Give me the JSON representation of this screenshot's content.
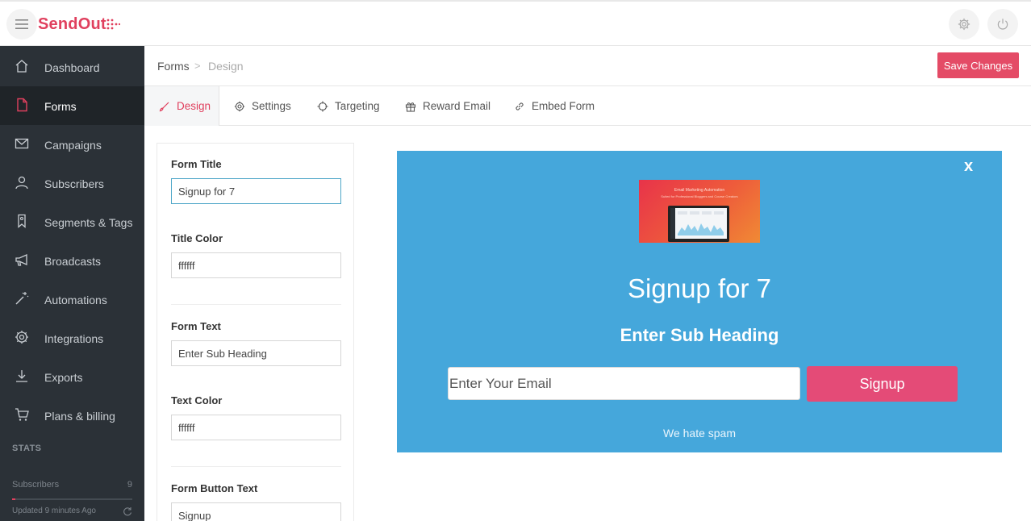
{
  "app": {
    "logo": "SendOut",
    "brand_color": "#e0405e"
  },
  "sidebar": {
    "items": [
      {
        "label": "Dashboard",
        "icon": "home-icon"
      },
      {
        "label": "Forms",
        "icon": "document-icon",
        "active": true
      },
      {
        "label": "Campaigns",
        "icon": "envelope-icon"
      },
      {
        "label": "Subscribers",
        "icon": "user-icon"
      },
      {
        "label": "Segments & Tags",
        "icon": "bookmark-icon"
      },
      {
        "label": "Broadcasts",
        "icon": "megaphone-icon"
      },
      {
        "label": "Automations",
        "icon": "magic-wand-icon"
      },
      {
        "label": "Integrations",
        "icon": "gear-icon"
      },
      {
        "label": "Exports",
        "icon": "download-icon"
      },
      {
        "label": "Plans & billing",
        "icon": "cart-icon"
      }
    ],
    "stats": {
      "title": "STATS",
      "subscribers_label": "Subscribers",
      "subscribers_value": "9",
      "updated": "Updated 9 minutes Ago"
    }
  },
  "breadcrumb": {
    "parent": "Forms",
    "current": "Design",
    "separator": ">"
  },
  "toolbar": {
    "save_label": "Save Changes"
  },
  "tabs": [
    {
      "label": "Design",
      "icon": "brush-icon",
      "active": true
    },
    {
      "label": "Settings",
      "icon": "gear-icon"
    },
    {
      "label": "Targeting",
      "icon": "crosshair-icon"
    },
    {
      "label": "Reward Email",
      "icon": "gift-icon"
    },
    {
      "label": "Embed Form",
      "icon": "link-icon"
    }
  ],
  "form": {
    "title_label": "Form Title",
    "title_value": "Signup for 7",
    "title_color_label": "Title Color",
    "title_color_value": "ffffff",
    "text_label": "Form Text",
    "text_value": "Enter Sub Heading",
    "text_color_label": "Text Color",
    "text_color_value": "ffffff",
    "button_text_label": "Form Button Text",
    "button_text_value": "Signup"
  },
  "preview": {
    "close": "x",
    "title": "Signup for 7",
    "subheading": "Enter Sub Heading",
    "email_placeholder": "Enter Your Email",
    "button": "Signup",
    "footer": "We hate spam",
    "image_heading": "Email Marketing Automation",
    "image_sub": "Suited for Professional Bloggers and Course Creators",
    "bg_color": "#45a7db",
    "button_color": "#e44b77"
  }
}
